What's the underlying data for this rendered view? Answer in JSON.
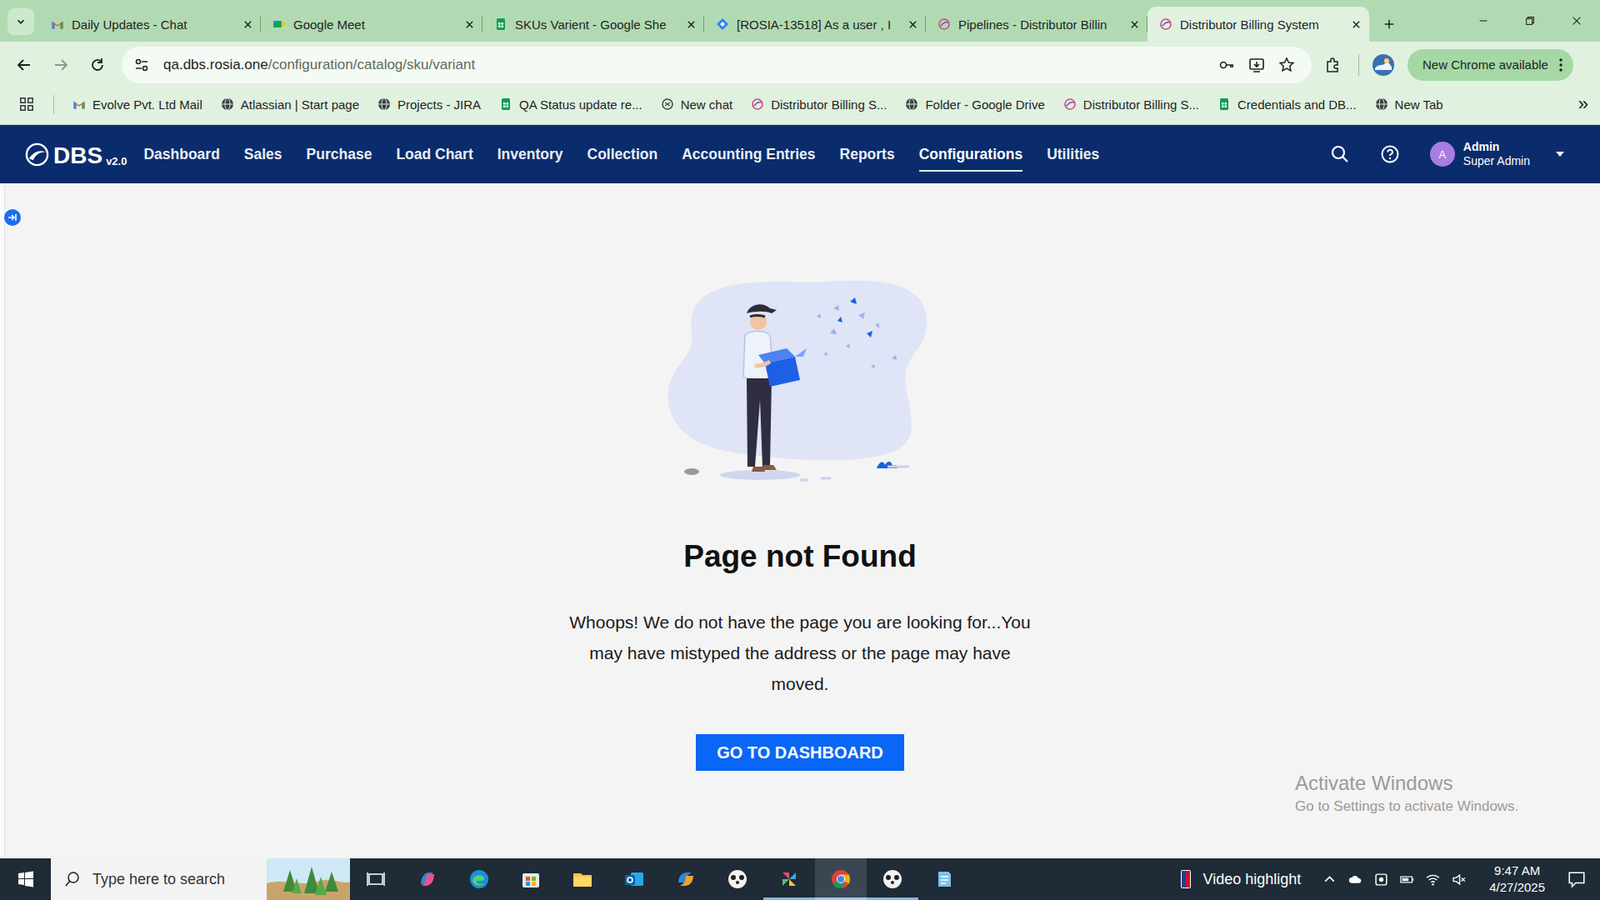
{
  "browser": {
    "tabs": [
      {
        "label": "Daily Updates - Chat",
        "selected": false
      },
      {
        "label": "Google Meet",
        "selected": false
      },
      {
        "label": "SKUs Varient - Google She",
        "selected": false
      },
      {
        "label": "[ROSIA-13518] As a user , I",
        "selected": false
      },
      {
        "label": "Pipelines - Distributor Billin",
        "selected": false
      },
      {
        "label": "Distributor Billing System",
        "selected": true
      }
    ],
    "address": {
      "host": "qa.dbs.rosia.one",
      "path": "/configuration/catalog/sku/variant"
    },
    "update_button": "New Chrome available",
    "bookmarks": [
      {
        "label": "Evolve Pvt. Ltd Mail"
      },
      {
        "label": "Atlassian | Start page"
      },
      {
        "label": "Projects - JIRA"
      },
      {
        "label": "QA Status update re..."
      },
      {
        "label": "New chat"
      },
      {
        "label": "Distributor Billing S..."
      },
      {
        "label": "Folder - Google Drive"
      },
      {
        "label": "Distributor Billing S..."
      },
      {
        "label": "Credentials and DB..."
      },
      {
        "label": "New Tab"
      }
    ],
    "bookmarks_more": "»"
  },
  "app": {
    "logo": "DBS",
    "version": "v2.0",
    "nav": [
      {
        "label": "Dashboard",
        "selected": false
      },
      {
        "label": "Sales",
        "selected": false
      },
      {
        "label": "Purchase",
        "selected": false
      },
      {
        "label": "Load Chart",
        "selected": false
      },
      {
        "label": "Inventory",
        "selected": false
      },
      {
        "label": "Collection",
        "selected": false
      },
      {
        "label": "Accounting Entries",
        "selected": false
      },
      {
        "label": "Reports",
        "selected": false
      },
      {
        "label": "Configurations",
        "selected": true
      },
      {
        "label": "Utilities",
        "selected": false
      }
    ],
    "user": {
      "initial": "A",
      "name": "Admin",
      "role": "Super Admin"
    }
  },
  "page": {
    "title": "Page not Found",
    "message": [
      "Whoops! We do not have the page you are looking for...",
      "You may have mistyped the address or the page may have moved."
    ],
    "button": "GO TO DASHBOARD"
  },
  "watermark": {
    "title": "Activate Windows",
    "subtitle": "Go to Settings to activate Windows."
  },
  "taskbar": {
    "search_placeholder": "Type here to search",
    "apps": [
      {
        "running": false,
        "active": false
      },
      {
        "running": false,
        "active": false
      },
      {
        "running": false,
        "active": false
      },
      {
        "running": false,
        "active": false
      },
      {
        "running": false,
        "active": false
      },
      {
        "running": false,
        "active": false
      },
      {
        "running": false,
        "active": false
      },
      {
        "running": true,
        "active": false
      },
      {
        "running": true,
        "active": true
      },
      {
        "running": true,
        "active": false
      },
      {
        "running": false,
        "active": false
      }
    ],
    "news": "Video highlight",
    "time": "9:47 AM",
    "date": "4/27/2025"
  }
}
